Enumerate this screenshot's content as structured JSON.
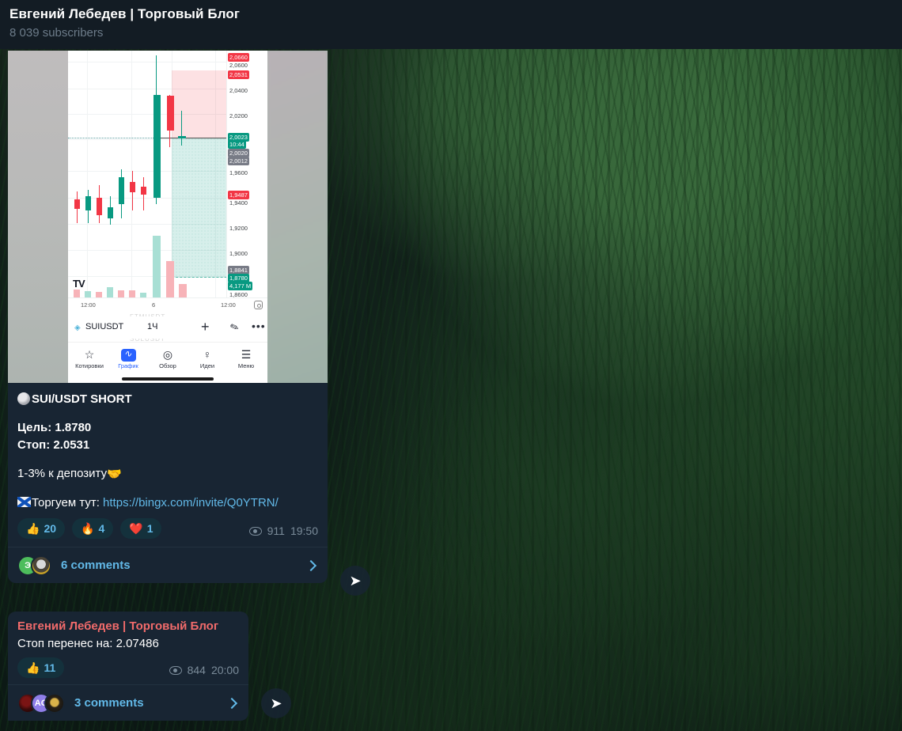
{
  "header": {
    "title": "Евгений Лебедев | Торговый Блог",
    "subscribers": "8 039 subscribers"
  },
  "message1": {
    "photo": {
      "app": "TradingView",
      "symbol": "SUIUSDT",
      "timeframe": "1Ч",
      "symbol_dot_icon": "water-drop-icon",
      "plus_icon": "+",
      "pen_icon": "✎",
      "more_icon": "•••",
      "ghost_text_1": "FTMUSDT",
      "ghost_text_2": "SOLUSDT",
      "price_ticks": [
        "2,0600",
        "2,0400",
        "2,0200",
        "1,9600",
        "1,9400",
        "1,9200",
        "1,9000",
        "1,8600"
      ],
      "price_chips": [
        {
          "label": "2,0660",
          "style": "red"
        },
        {
          "label": "2,0531",
          "style": "red"
        },
        {
          "label": "2,0023",
          "style": "green"
        },
        {
          "label": "10:44",
          "style": "green"
        },
        {
          "label": "2,0020",
          "style": "grey"
        },
        {
          "label": "2,0012",
          "style": "grey"
        },
        {
          "label": "1,9487",
          "style": "red"
        },
        {
          "label": "1,8841",
          "style": "grey"
        },
        {
          "label": "1,8780",
          "style": "green"
        },
        {
          "label": "4,177 M",
          "style": "green"
        }
      ],
      "time_ticks": [
        "12:00",
        "6",
        "12:00"
      ],
      "axis_settings_icon": "gear-icon",
      "nav": [
        {
          "label": "Котировки",
          "glyph": "☆",
          "icon": "star-icon",
          "active": false
        },
        {
          "label": "График",
          "glyph": "",
          "icon": "chart-icon",
          "active": true
        },
        {
          "label": "Обзор",
          "glyph": "◎",
          "icon": "compass-icon",
          "active": false
        },
        {
          "label": "Идеи",
          "glyph": "♀",
          "icon": "bulb-icon",
          "active": false
        },
        {
          "label": "Меню",
          "glyph": "☰",
          "icon": "menu-icon",
          "active": false
        }
      ]
    },
    "text": {
      "title": "SUI/USDT SHORT",
      "title_emoji": "moon-emoji",
      "target": "Цель: 1.8780",
      "stop": "Стоп: 2.0531",
      "deposit": "1-3% к депозиту",
      "deposit_emoji": "handshake-emoji",
      "trade_prefix": "Торгуем тут: ",
      "trade_flag_emoji": "scotland-flag-emoji",
      "trade_link": "https://bingx.com/invite/Q0YTRN/"
    },
    "reactions": [
      {
        "emoji": "👍",
        "name": "thumbs-up",
        "count": "20"
      },
      {
        "emoji": "🔥",
        "name": "fire",
        "count": "4"
      },
      {
        "emoji": "❤️",
        "name": "heart",
        "count": "1"
      }
    ],
    "views": "911",
    "time": "19:50",
    "comments_label": "6 comments",
    "comment_avatars": [
      {
        "type": "green",
        "initials": "Э"
      },
      {
        "type": "emblem",
        "initials": ""
      }
    ]
  },
  "message2": {
    "author": "Евгений Лебедев | Торговый Блог",
    "text": "Стоп перенес на: 2.07486",
    "reactions": [
      {
        "emoji": "👍",
        "name": "thumbs-up",
        "count": "11"
      }
    ],
    "views": "844",
    "time": "20:00",
    "comments_label": "3 comments",
    "comment_avatars": [
      {
        "type": "dark",
        "initials": ""
      },
      {
        "type": "purple",
        "initials": "AG"
      },
      {
        "type": "gold",
        "initials": ""
      }
    ]
  },
  "share_button": {
    "glyph": "➤",
    "icon": "share-arrow-icon"
  },
  "colors": {
    "accent_link": "#62b9e8",
    "author_red": "#f26b6b",
    "bubble": "#182533",
    "header_bg": "#131c24",
    "bull": "#089981",
    "bear": "#f23645"
  }
}
